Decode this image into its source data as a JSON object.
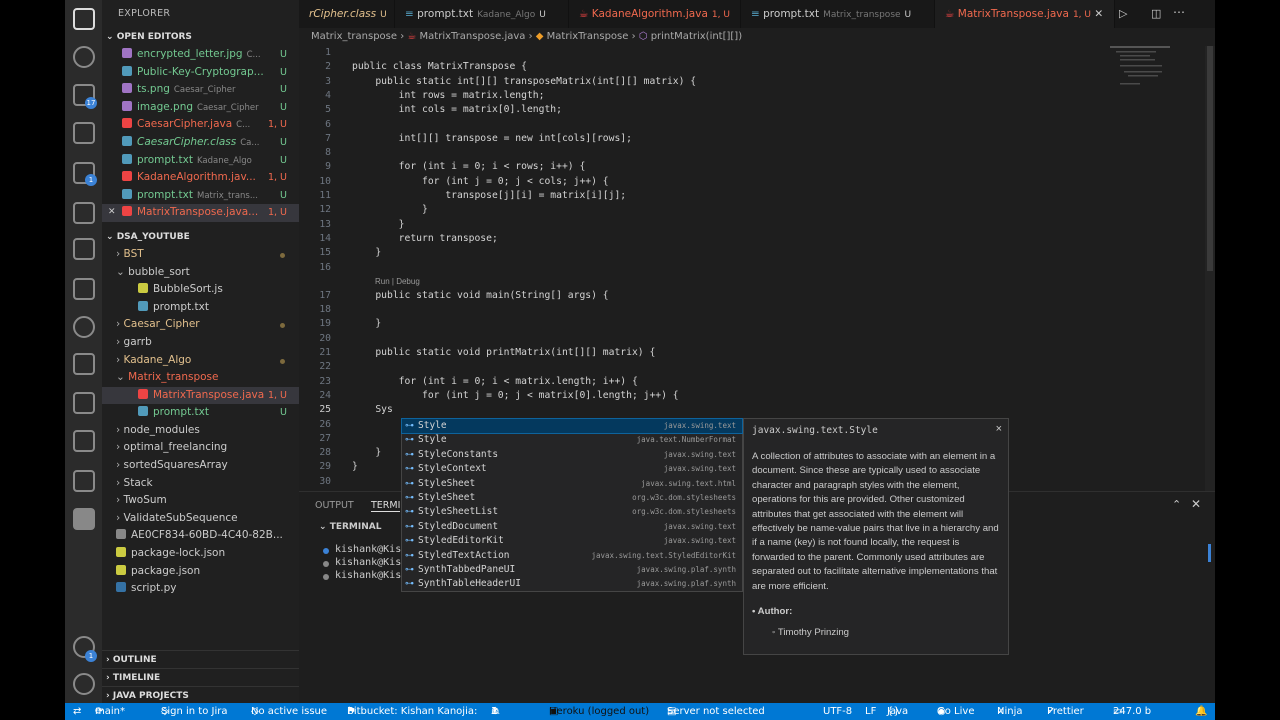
{
  "sidebar": {
    "title": "EXPLORER",
    "open_editors_label": "OPEN EDITORS",
    "open_editors": [
      {
        "name": "encrypted_letter.jpg",
        "sub": "C...",
        "status": "U",
        "color": "#73c991",
        "icon": "image-icon",
        "ico_color": "#a074c4"
      },
      {
        "name": "Public-Key-Cryptograp...",
        "sub": "",
        "status": "U",
        "color": "#73c991",
        "icon": "markdown-icon",
        "ico_color": "#519aba"
      },
      {
        "name": "ts.png",
        "sub": "Caesar_Cipher",
        "status": "U",
        "color": "#73c991",
        "icon": "image-icon",
        "ico_color": "#a074c4"
      },
      {
        "name": "image.png",
        "sub": "Caesar_Cipher",
        "status": "U",
        "color": "#73c991",
        "icon": "image-icon",
        "ico_color": "#a074c4"
      },
      {
        "name": "CaesarCipher.java",
        "sub": "C...",
        "status": "1, U",
        "color": "#f0694e",
        "icon": "java-icon",
        "ico_color": "#e44"
      },
      {
        "name": "CaesarCipher.class",
        "sub": "Ca...",
        "status": "U",
        "color": "#73c991",
        "icon": "class-file-icon",
        "ico_color": "#519aba"
      },
      {
        "name": "prompt.txt",
        "sub": "Kadane_Algo",
        "status": "U",
        "color": "#73c991",
        "icon": "text-file-icon",
        "ico_color": "#519aba"
      },
      {
        "name": "KadaneAlgorithm.jav...",
        "sub": "",
        "status": "1, U",
        "color": "#f0694e",
        "icon": "java-icon",
        "ico_color": "#e44"
      },
      {
        "name": "prompt.txt",
        "sub": "Matrix_trans...",
        "status": "U",
        "color": "#73c991",
        "icon": "text-file-icon",
        "ico_color": "#519aba"
      },
      {
        "name": "MatrixTranspose.java...",
        "sub": "",
        "status": "1, U",
        "color": "#f0694e",
        "icon": "java-icon",
        "ico_color": "#e44"
      }
    ],
    "workspace_label": "DSA_YOUTUBE",
    "tree": [
      {
        "name": "BST",
        "indent": 0,
        "kind": "folder",
        "color": "#e2c08d",
        "status": "dot"
      },
      {
        "name": "bubble_sort",
        "indent": 0,
        "kind": "folder-open",
        "color": "#cccccc",
        "status": ""
      },
      {
        "name": "BubbleSort.js",
        "indent": 1,
        "kind": "js",
        "color": "#cccccc",
        "status": ""
      },
      {
        "name": "prompt.txt",
        "indent": 1,
        "kind": "txt",
        "color": "#cccccc",
        "status": ""
      },
      {
        "name": "Caesar_Cipher",
        "indent": 0,
        "kind": "folder",
        "color": "#e2c08d",
        "status": "dot"
      },
      {
        "name": "garrb",
        "indent": 0,
        "kind": "folder",
        "color": "#cccccc",
        "status": ""
      },
      {
        "name": "Kadane_Algo",
        "indent": 0,
        "kind": "folder",
        "color": "#e2c08d",
        "status": "dot"
      },
      {
        "name": "Matrix_transpose",
        "indent": 0,
        "kind": "folder-open",
        "color": "#f0694e",
        "status": ""
      },
      {
        "name": "MatrixTranspose.java",
        "indent": 1,
        "kind": "java",
        "color": "#f0694e",
        "status": "1, U"
      },
      {
        "name": "prompt.txt",
        "indent": 1,
        "kind": "txt",
        "color": "#73c991",
        "status": "U"
      },
      {
        "name": "node_modules",
        "indent": 0,
        "kind": "folder",
        "color": "#cccccc",
        "status": ""
      },
      {
        "name": "optimal_freelancing",
        "indent": 0,
        "kind": "folder",
        "color": "#cccccc",
        "status": ""
      },
      {
        "name": "sortedSquaresArray",
        "indent": 0,
        "kind": "folder",
        "color": "#cccccc",
        "status": ""
      },
      {
        "name": "Stack",
        "indent": 0,
        "kind": "folder",
        "color": "#cccccc",
        "status": ""
      },
      {
        "name": "TwoSum",
        "indent": 0,
        "kind": "folder",
        "color": "#cccccc",
        "status": ""
      },
      {
        "name": "ValidateSubSequence",
        "indent": 0,
        "kind": "folder",
        "color": "#cccccc",
        "status": ""
      },
      {
        "name": "AE0CF834-60BD-4C40-82B...",
        "indent": 0,
        "kind": "file",
        "color": "#cccccc",
        "status": ""
      },
      {
        "name": "package-lock.json",
        "indent": 0,
        "kind": "json",
        "color": "#cccccc",
        "status": ""
      },
      {
        "name": "package.json",
        "indent": 0,
        "kind": "json",
        "color": "#cccccc",
        "status": ""
      },
      {
        "name": "script.py",
        "indent": 0,
        "kind": "py",
        "color": "#cccccc",
        "status": ""
      }
    ],
    "outline_label": "OUTLINE",
    "timeline_label": "TIMELINE",
    "java_projects_label": "JAVA PROJECTS"
  },
  "activity": {
    "source_control_badge": "17",
    "extensions_badge": "1",
    "accounts_badge": "1"
  },
  "tabs": [
    {
      "name": "CaesarCipher.class",
      "display": "rCipher.class",
      "sub": "",
      "status": "U",
      "color": "#e2c08d",
      "icon": "class-file-icon"
    },
    {
      "name": "prompt.txt",
      "display": "prompt.txt",
      "sub": "Kadane_Algo",
      "status": "U",
      "color": "#cccccc",
      "icon": "text-file-icon"
    },
    {
      "name": "KadaneAlgorithm.java",
      "display": "KadaneAlgorithm.java",
      "sub": "",
      "status": "1, U",
      "color": "#f0694e",
      "icon": "java-icon"
    },
    {
      "name": "prompt.txt",
      "display": "prompt.txt",
      "sub": "Matrix_transpose",
      "status": "U",
      "color": "#cccccc",
      "icon": "text-file-icon"
    },
    {
      "name": "MatrixTranspose.java",
      "display": "MatrixTranspose.java",
      "sub": "",
      "status": "1, U",
      "color": "#f0694e",
      "icon": "java-icon",
      "active": true
    }
  ],
  "breadcrumb": [
    "Matrix_transpose",
    "MatrixTranspose.java",
    "MatrixTranspose",
    "printMatrix(int[][])"
  ],
  "editor": {
    "codelens": "Run | Debug",
    "lines": [
      {
        "n": "1",
        "text": ""
      },
      {
        "n": "2",
        "text": "public class MatrixTranspose {"
      },
      {
        "n": "3",
        "text": "    public static int[][] transposeMatrix(int[][] matrix) {"
      },
      {
        "n": "4",
        "text": "        int rows = matrix.length;"
      },
      {
        "n": "5",
        "text": "        int cols = matrix[0].length;"
      },
      {
        "n": "6",
        "text": ""
      },
      {
        "n": "7",
        "text": "        int[][] transpose = new int[cols][rows];"
      },
      {
        "n": "8",
        "text": ""
      },
      {
        "n": "9",
        "text": "        for (int i = 0; i < rows; i++) {"
      },
      {
        "n": "10",
        "text": "            for (int j = 0; j < cols; j++) {"
      },
      {
        "n": "11",
        "text": "                transpose[j][i] = matrix[i][j];"
      },
      {
        "n": "12",
        "text": "            }"
      },
      {
        "n": "13",
        "text": "        }"
      },
      {
        "n": "14",
        "text": "        return transpose;"
      },
      {
        "n": "15",
        "text": "    }"
      },
      {
        "n": "16",
        "text": ""
      },
      {
        "n": "17",
        "text": "    public static void main(String[] args) {"
      },
      {
        "n": "18",
        "text": ""
      },
      {
        "n": "19",
        "text": "    }"
      },
      {
        "n": "20",
        "text": ""
      },
      {
        "n": "21",
        "text": "    public static void printMatrix(int[][] matrix) {"
      },
      {
        "n": "22",
        "text": ""
      },
      {
        "n": "23",
        "text": "        for (int i = 0; i < matrix.length; i++) {"
      },
      {
        "n": "24",
        "text": "            for (int j = 0; j < matrix[0].length; j++) {"
      },
      {
        "n": "25",
        "text": "    Sys"
      },
      {
        "n": "26",
        "text": ""
      },
      {
        "n": "27",
        "text": ""
      },
      {
        "n": "28",
        "text": "    }"
      },
      {
        "n": "29",
        "text": "}"
      },
      {
        "n": "30",
        "text": ""
      }
    ]
  },
  "suggest": {
    "items": [
      {
        "label": "Style",
        "pkg": "javax.swing.text"
      },
      {
        "label": "Style",
        "pkg": "java.text.NumberFormat"
      },
      {
        "label": "StyleConstants",
        "pkg": "javax.swing.text"
      },
      {
        "label": "StyleContext",
        "pkg": "javax.swing.text"
      },
      {
        "label": "StyleSheet",
        "pkg": "javax.swing.text.html"
      },
      {
        "label": "StyleSheet",
        "pkg": "org.w3c.dom.stylesheets"
      },
      {
        "label": "StyleSheetList",
        "pkg": "org.w3c.dom.stylesheets"
      },
      {
        "label": "StyledDocument",
        "pkg": "javax.swing.text"
      },
      {
        "label": "StyledEditorKit",
        "pkg": "javax.swing.text"
      },
      {
        "label": "StyledTextAction",
        "pkg": "javax.swing.text.StyledEditorKit"
      },
      {
        "label": "SynthTabbedPaneUI",
        "pkg": "javax.swing.plaf.synth"
      },
      {
        "label": "SynthTableHeaderUI",
        "pkg": "javax.swing.plaf.synth"
      }
    ],
    "doc_title": "javax.swing.text.Style",
    "doc_body": "A collection of attributes to associate with an element in a document. Since these are typically used to associate character and paragraph styles with the element, operations for this are provided. Other customized attributes that get associated with the element will effectively be name-value pairs that live in a hierarchy and if a name (key) is not found locally, the request is forwarded to the parent. Commonly used attributes are separated out to facilitate alternative implementations that are more efficient.",
    "doc_author_label": "Author:",
    "doc_author": "Timothy Prinzing",
    "close_glyph": "×"
  },
  "panel": {
    "tab_output": "OUTPUT",
    "tab_terminal": "TERMI",
    "terminal_section": "TERMINAL",
    "terminal_lines": [
      "kishank@Kish",
      "kishank@Kish",
      "kishank@Kish"
    ]
  },
  "statusbar": {
    "branch": "main*",
    "jira": "Sign in to Jira",
    "issue": "No active issue",
    "bitbucket": "Bitbucket: Kishan Kanojia:",
    "problems": "3",
    "warnings": "1",
    "heroku": "Heroku (logged out)",
    "server": "Server not selected",
    "encoding": "UTF-8",
    "eol": "LF",
    "language": "Java",
    "golive": "Go Live",
    "ninja": "Ninja",
    "prettier": "Prettier",
    "size": "247.0 b"
  },
  "colors": {
    "accent": "#0078d4",
    "modified": "#e2c08d",
    "untracked": "#73c991",
    "error": "#f0694e"
  }
}
